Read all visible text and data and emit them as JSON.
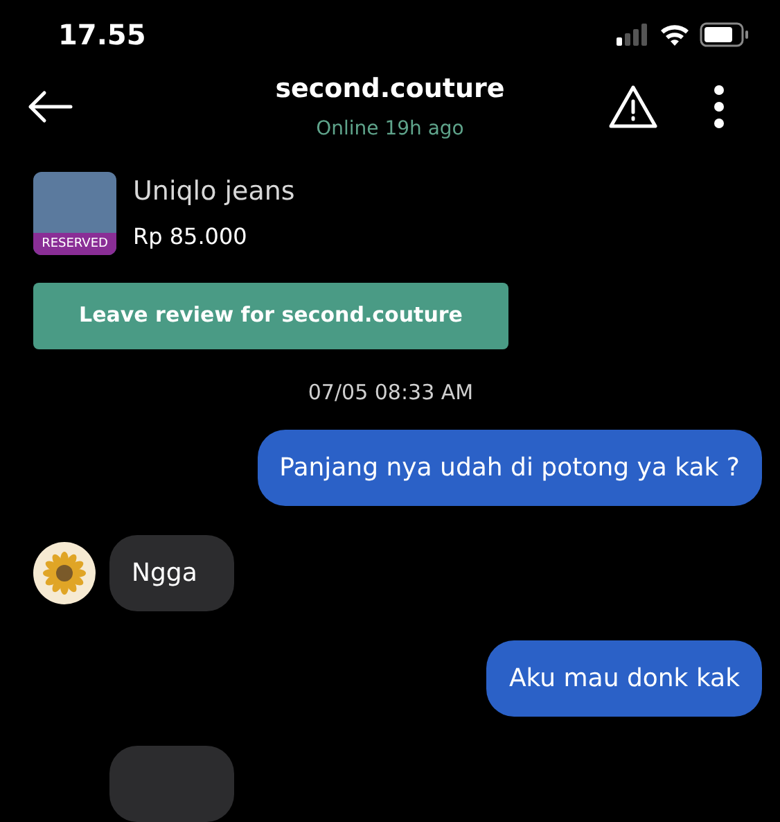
{
  "status_bar": {
    "time": "17.55"
  },
  "header": {
    "title": "second.couture",
    "subtitle": "Online 19h ago"
  },
  "product": {
    "name": "Uniqlo jeans",
    "price": "Rp 85.000",
    "badge": "RESERVED"
  },
  "review_button": {
    "label": "Leave review for second.couture"
  },
  "timestamp": "07/05 08:33 AM",
  "messages": [
    {
      "kind": "sent",
      "text": "Panjang nya udah di potong ya kak ?"
    },
    {
      "kind": "received",
      "text": "Ngga",
      "avatar": true
    },
    {
      "kind": "sent",
      "text": "Aku mau donk kak"
    },
    {
      "kind": "received",
      "avatar": false
    }
  ]
}
